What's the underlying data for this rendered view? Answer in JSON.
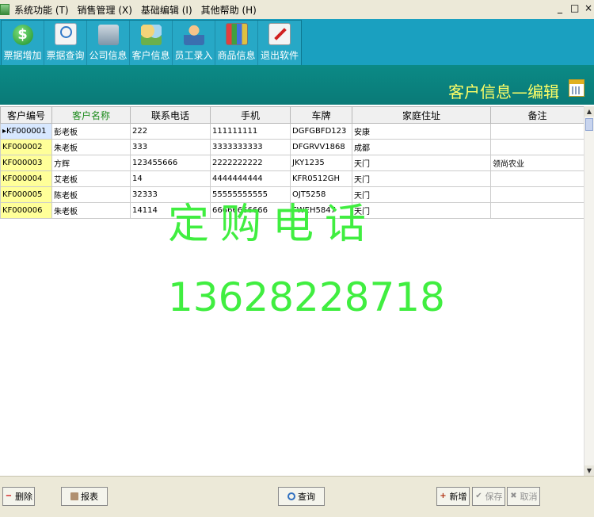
{
  "menu": {
    "items": [
      {
        "label": "系统功能 (T)"
      },
      {
        "label": "销售管理 (X)"
      },
      {
        "label": "基础编辑 (I)"
      },
      {
        "label": "其他帮助 (H)"
      }
    ],
    "window_controls": {
      "minimize": "_",
      "restore": "□",
      "close": "×"
    }
  },
  "toolbar": {
    "buttons": [
      {
        "label": "票据增加",
        "icon": "money-icon"
      },
      {
        "label": "票据查询",
        "icon": "search-doc-icon"
      },
      {
        "label": "公司信息",
        "icon": "company-icon"
      },
      {
        "label": "客户信息",
        "icon": "customers-icon"
      },
      {
        "label": "员工录入",
        "icon": "staff-icon"
      },
      {
        "label": "商品信息",
        "icon": "goods-icon"
      },
      {
        "label": "退出软件",
        "icon": "exit-icon"
      }
    ]
  },
  "form": {
    "title": "客户信息—编辑"
  },
  "table": {
    "columns": [
      "客户编号",
      "客户名称",
      "联系电话",
      "手机",
      "车牌",
      "家庭住址",
      "备注"
    ],
    "rows": [
      [
        "KF000001",
        "彭老板",
        "222",
        "111111111",
        "DGFGBFD123",
        "安康",
        ""
      ],
      [
        "KF000002",
        "朱老板",
        "333",
        "3333333333",
        "DFGRVV1868",
        "成都",
        ""
      ],
      [
        "KF000003",
        "方辉",
        "123455666",
        "2222222222",
        "JKY1235",
        "天门",
        "领尚农业"
      ],
      [
        "KF000004",
        "艾老板",
        "14",
        "4444444444",
        "KFR0512GH",
        "天门",
        ""
      ],
      [
        "KF000005",
        "陈老板",
        "32333",
        "55555555555",
        "OJT5258",
        "天门",
        ""
      ],
      [
        "KF000006",
        "朱老板",
        "14114",
        "66666666666",
        "FWEH5847",
        "天门",
        ""
      ]
    ],
    "selected_row_marker": "▸"
  },
  "watermark": {
    "line1": "定购电话",
    "line2": "13628228718"
  },
  "buttons": {
    "delete": "删除",
    "report": "报表",
    "query": "查询",
    "add": "新增",
    "save": "保存",
    "cancel": "取消"
  },
  "colors": {
    "toolbar": "#1aa0c0",
    "title_band": "#0b8a86",
    "title_text": "#ffff66",
    "watermark": "#40ee40",
    "code_cell": "#ffff99"
  }
}
